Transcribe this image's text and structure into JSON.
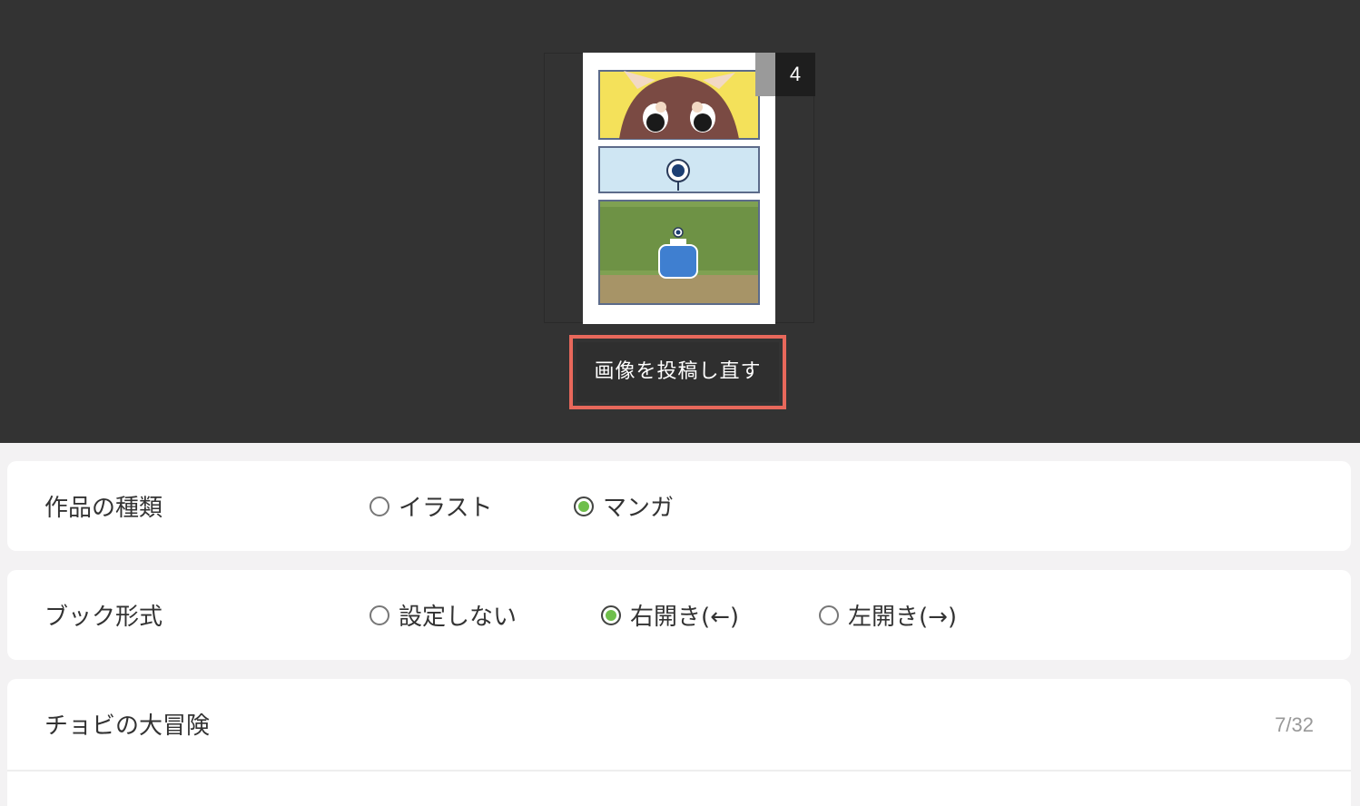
{
  "thumbnail": {
    "page_count": "4"
  },
  "reupload": {
    "label": "画像を投稿し直す",
    "highlight_color": "#e8685b"
  },
  "work_type": {
    "label": "作品の種類",
    "options": [
      {
        "label": "イラスト",
        "selected": false
      },
      {
        "label": "マンガ",
        "selected": true
      }
    ]
  },
  "book_format": {
    "label": "ブック形式",
    "options": [
      {
        "label": "設定しない",
        "selected": false
      },
      {
        "label": "右開き(←)",
        "selected": true
      },
      {
        "label": "左開き(→)",
        "selected": false
      }
    ]
  },
  "title_field": {
    "value": "チョビの大冒険",
    "counter": "7/32"
  },
  "colors": {
    "background_dark": "#333333",
    "accent_green": "#6fbf4b"
  }
}
